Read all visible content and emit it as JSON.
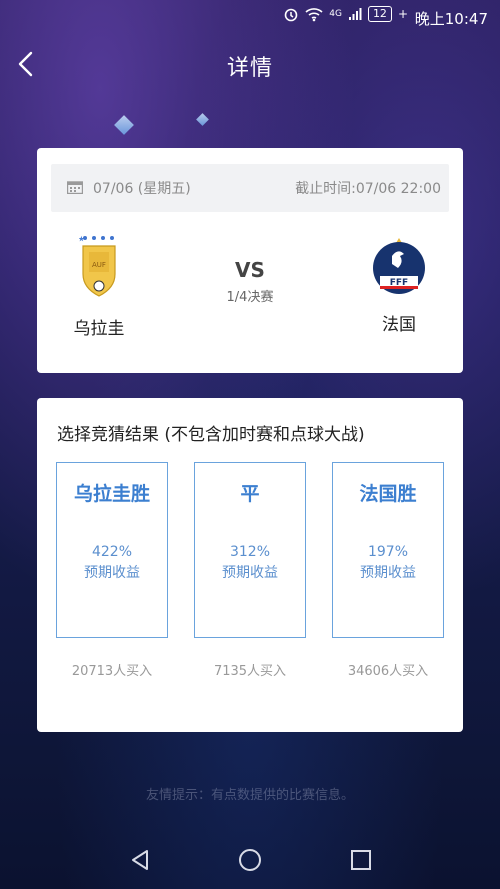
{
  "status_bar": {
    "network": "4G",
    "battery": "12",
    "time": "晚上10:47"
  },
  "header": {
    "title": "详情"
  },
  "match": {
    "date": "07/06 (星期五)",
    "deadline": "截止时间:07/06 22:00",
    "home_team": "乌拉圭",
    "away_team": "法国",
    "vs": "VS",
    "stage": "1/4决赛"
  },
  "bet": {
    "title": "选择竞猜结果 (不包含加时赛和点球大战)",
    "options": [
      {
        "name": "乌拉圭胜",
        "rate": "422%",
        "label": "预期收益",
        "buyers": "20713人买入"
      },
      {
        "name": "平",
        "rate": "312%",
        "label": "预期收益",
        "buyers": "7135人买入"
      },
      {
        "name": "法国胜",
        "rate": "197%",
        "label": "预期收益",
        "buyers": "34606人买入"
      }
    ]
  },
  "tip": "友情提示：有点数提供的比赛信息。",
  "colors": {
    "accent": "#3c7fd0",
    "option_border": "#6aa3dd",
    "background_top": "#2a1f5e",
    "background_bottom": "#0b1230"
  }
}
